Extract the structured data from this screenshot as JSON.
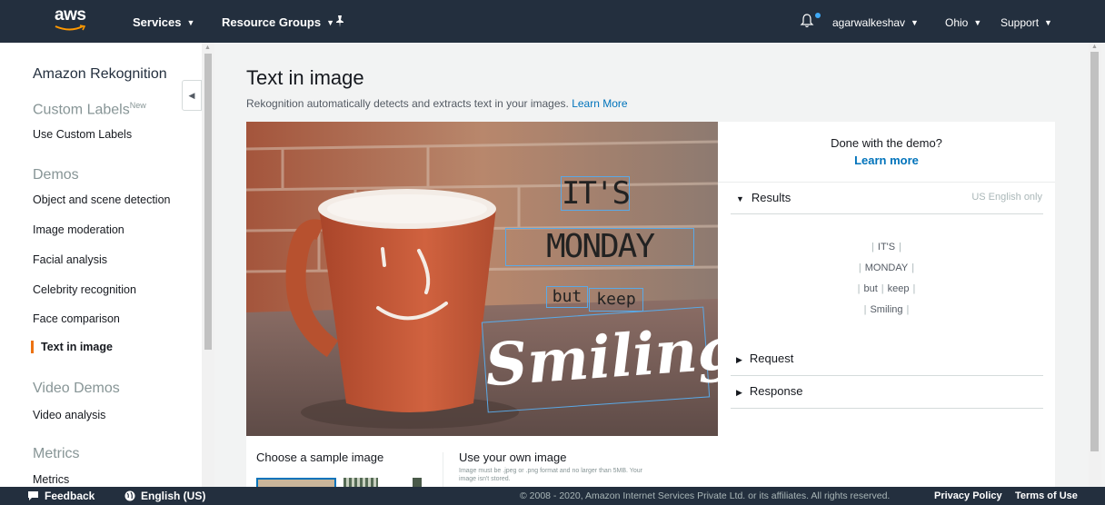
{
  "nav": {
    "logo": "aws",
    "services": "Services",
    "resource_groups": "Resource Groups",
    "user": "agarwalkeshav",
    "region": "Ohio",
    "support": "Support"
  },
  "sidebar": {
    "title": "Amazon Rekognition",
    "custom_labels": {
      "heading": "Custom Labels",
      "badge": "New",
      "items": [
        "Use Custom Labels"
      ]
    },
    "demos": {
      "heading": "Demos",
      "items": [
        "Object and scene detection",
        "Image moderation",
        "Facial analysis",
        "Celebrity recognition",
        "Face comparison",
        "Text in image"
      ]
    },
    "video_demos": {
      "heading": "Video Demos",
      "items": [
        "Video analysis"
      ]
    },
    "metrics": {
      "heading": "Metrics",
      "items": [
        "Metrics"
      ]
    }
  },
  "main": {
    "title": "Text in image",
    "subtitle": "Rekognition automatically detects and extracts text in your images.",
    "learn_more_link": "Learn More"
  },
  "image": {
    "text_its": "IT'S",
    "text_monday": "MONDAY",
    "text_but": "but",
    "text_keep": "keep",
    "text_smiling": "Smiling"
  },
  "results_panel": {
    "done_text": "Done with the demo?",
    "learn_more": "Learn more",
    "results_label": "Results",
    "results_note": "US English only",
    "lines": [
      [
        "IT'S"
      ],
      [
        "MONDAY"
      ],
      [
        "but",
        "keep"
      ],
      [
        "Smiling"
      ]
    ],
    "request_label": "Request",
    "response_label": "Response"
  },
  "sample": {
    "choose_label": "Choose a sample image",
    "own_label": "Use your own image",
    "own_note": "Image must be .jpeg or .png format and no larger than 5MB. Your image isn't stored."
  },
  "footer": {
    "feedback": "Feedback",
    "language": "English (US)",
    "copyright": "© 2008 - 2020, Amazon Internet Services Private Ltd. or its affiliates. All rights reserved.",
    "privacy": "Privacy Policy",
    "terms": "Terms of Use"
  },
  "colors": {
    "nav_bg": "#232f3e",
    "link": "#0073bb",
    "accent": "#ec7211",
    "bbox": "#5aa9e6"
  }
}
